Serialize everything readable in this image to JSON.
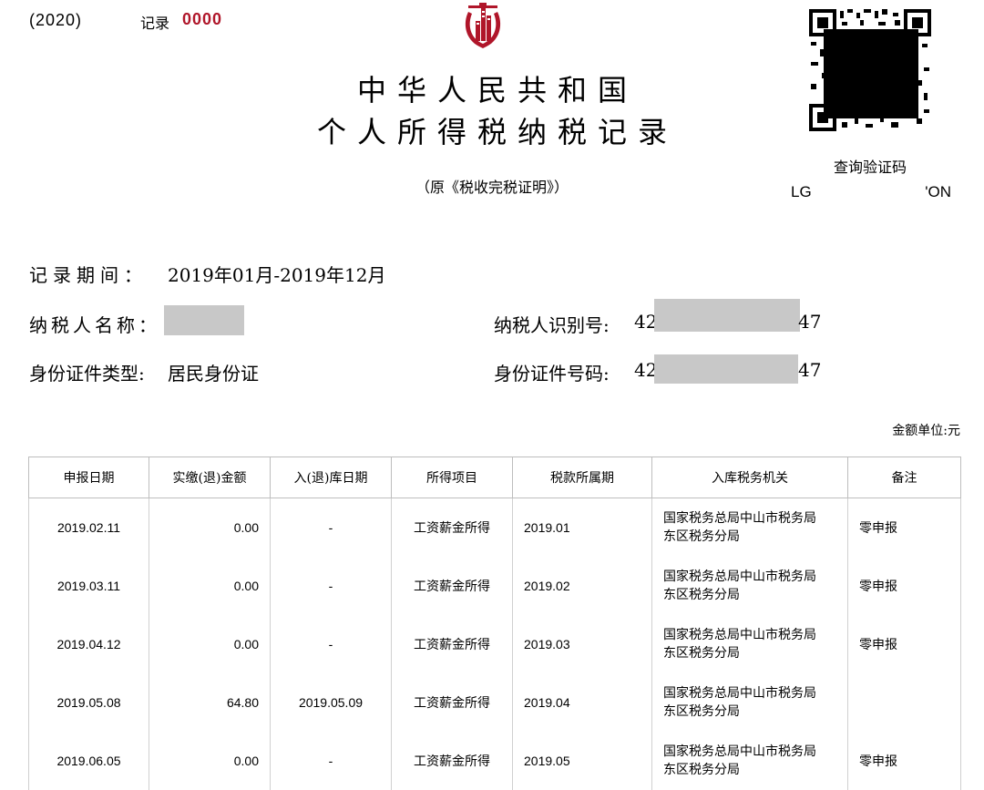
{
  "header": {
    "year": "(2020)",
    "record_label": "记录",
    "record_number": "0000",
    "title_line1": "中华人民共和国",
    "title_line2": "个人所得税纳税记录",
    "subtitle": "（原《税收完税证明》）",
    "verify_label": "查询验证码",
    "verify_code_start": "LG",
    "verify_code_end": "'ON"
  },
  "info": {
    "period_label": "记录期间：",
    "period_value": "2019年01月-2019年12月",
    "name_label": "纳税人名称：",
    "tin_label": "纳税人识别号:",
    "tin_prefix": "42",
    "tin_suffix": "47",
    "id_type_label": "身份证件类型:",
    "id_type_value": "居民身份证",
    "id_no_label": "身份证件号码:",
    "id_no_prefix": "42",
    "id_no_suffix": "47"
  },
  "unit_label": "金额单位:元",
  "table": {
    "headers": [
      "申报日期",
      "实缴(退)金额",
      "入(退)库日期",
      "所得项目",
      "税款所属期",
      "入库税务机关",
      "备注"
    ],
    "rows": [
      {
        "declare_date": "2019.02.11",
        "amount": "0.00",
        "storage_date": "-",
        "item": "工资薪金所得",
        "period": "2019.01",
        "office_line1": "国家税务总局中山市税务局",
        "office_line2": "东区税务分局",
        "remark": "零申报"
      },
      {
        "declare_date": "2019.03.11",
        "amount": "0.00",
        "storage_date": "-",
        "item": "工资薪金所得",
        "period": "2019.02",
        "office_line1": "国家税务总局中山市税务局",
        "office_line2": "东区税务分局",
        "remark": "零申报"
      },
      {
        "declare_date": "2019.04.12",
        "amount": "0.00",
        "storage_date": "-",
        "item": "工资薪金所得",
        "period": "2019.03",
        "office_line1": "国家税务总局中山市税务局",
        "office_line2": "东区税务分局",
        "remark": "零申报"
      },
      {
        "declare_date": "2019.05.08",
        "amount": "64.80",
        "storage_date": "2019.05.09",
        "item": "工资薪金所得",
        "period": "2019.04",
        "office_line1": "国家税务总局中山市税务局",
        "office_line2": "东区税务分局",
        "remark": ""
      },
      {
        "declare_date": "2019.06.05",
        "amount": "0.00",
        "storage_date": "-",
        "item": "工资薪金所得",
        "period": "2019.05",
        "office_line1": "国家税务总局中山市税务局",
        "office_line2": "东区税务分局",
        "remark": "零申报"
      }
    ]
  },
  "colors": {
    "emblem_red": "#b0162a",
    "record_number_red": "#b0162a",
    "redaction_gray": "#c8c8c8",
    "table_border": "#bdbdbd"
  },
  "icons": {
    "emblem": "tax-bureau-emblem-icon",
    "qr": "qr-code-icon"
  }
}
